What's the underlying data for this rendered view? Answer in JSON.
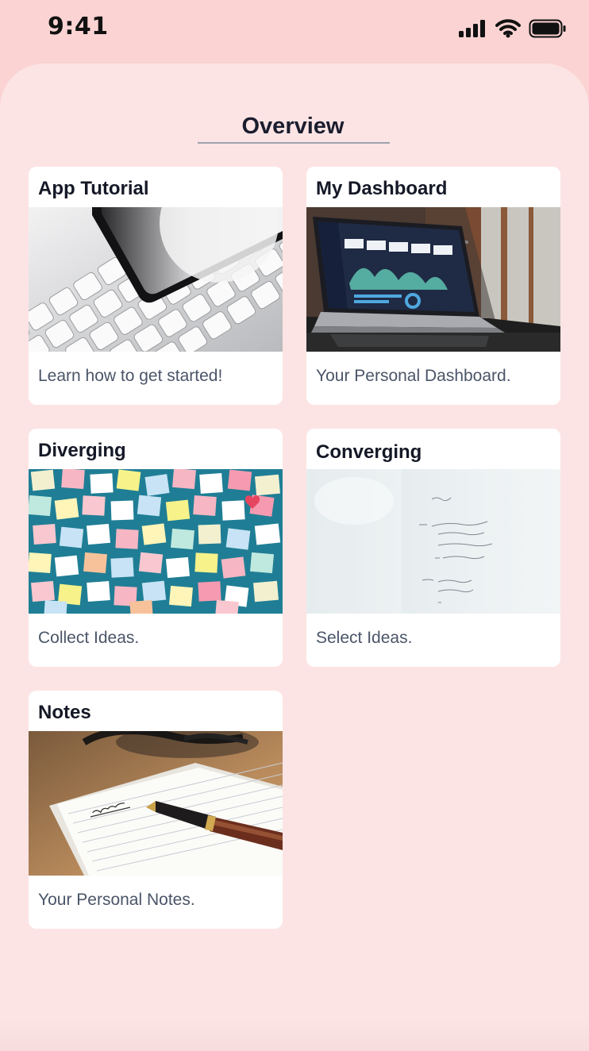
{
  "status_bar": {
    "time": "9:41",
    "icons": [
      "cellular-signal-icon",
      "wifi-icon",
      "battery-icon"
    ]
  },
  "page": {
    "title": "Overview"
  },
  "cards": [
    {
      "title": "App Tutorial",
      "description": "Learn how to get started!",
      "image": "phone-on-keyboard-photo"
    },
    {
      "title": "My Dashboard",
      "description": "Your Personal Dashboard.",
      "image": "laptop-dashboard-photo"
    },
    {
      "title": "Diverging",
      "description": "Collect Ideas.",
      "image": "sticky-notes-wall-photo"
    },
    {
      "title": "Converging",
      "description": "Select Ideas.",
      "image": "whiteboard-photo"
    },
    {
      "title": "Notes",
      "description": "Your Personal Notes.",
      "image": "notebook-and-pen-photo"
    }
  ],
  "colors": {
    "status_background": "#fbd3d3",
    "sheet_background": "#fde4e4",
    "card_background": "#ffffff",
    "title_text": "#151826",
    "description_text": "#4a5568"
  }
}
